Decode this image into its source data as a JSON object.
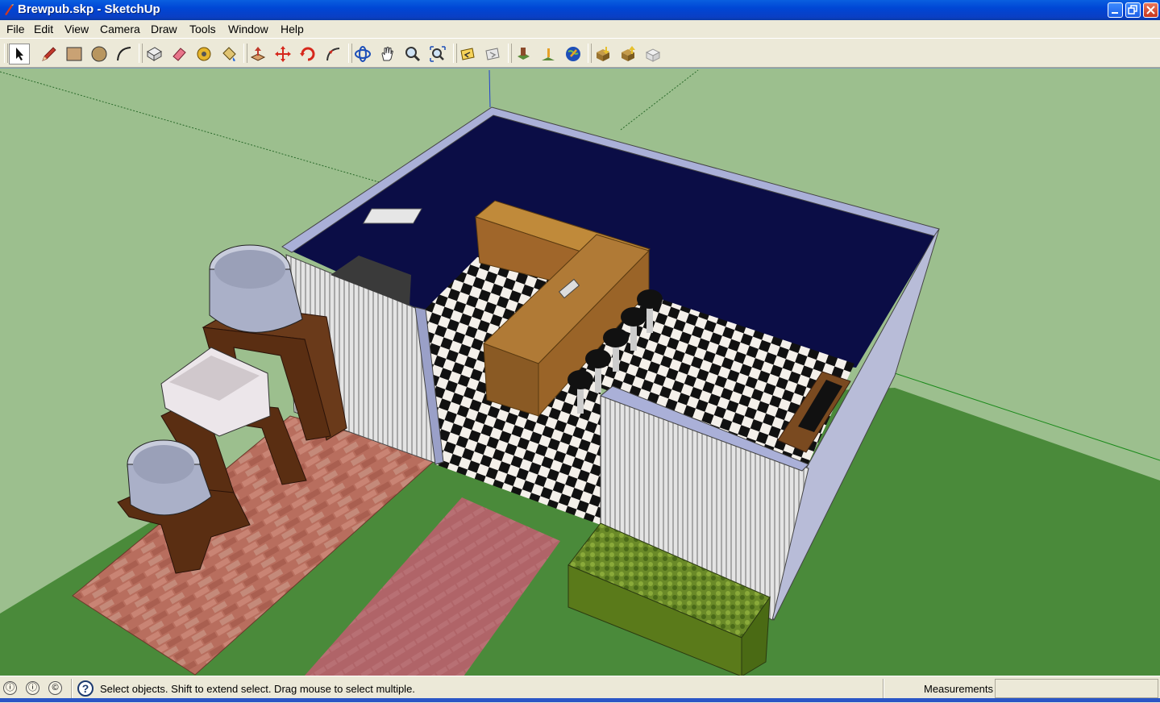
{
  "window": {
    "title": "Brewpub.skp - SketchUp"
  },
  "menu": [
    "File",
    "Edit",
    "View",
    "Camera",
    "Draw",
    "Tools",
    "Window",
    "Help"
  ],
  "toolbar": {
    "tools": [
      "select-tool",
      "pencil-tool",
      "rectangle-tool",
      "circle-tool",
      "arc-tool",
      "make-component-tool",
      "eraser-tool",
      "tape-measure-tool",
      "paint-bucket-tool",
      "push-pull-tool",
      "move-tool",
      "rotate-tool",
      "follow-me-tool",
      "orbit-tool",
      "pan-tool",
      "zoom-tool",
      "zoom-extents-tool",
      "previous-view-tool",
      "next-view-tool",
      "add-location-tool",
      "toggle-terrain-tool",
      "google-earth-tool",
      "get-models-tool",
      "share-model-tool",
      "send-to-layout-tool"
    ]
  },
  "status": {
    "message": "Select objects. Shift to extend select. Drag mouse to select multiple.",
    "measurements_label": "Measurements",
    "measurements_value": ""
  },
  "colors": {
    "sky": "#9cbf8e",
    "ground": "#4a8a3a",
    "wall_dark": "#0b0d46",
    "titlebar": "#0a50d8"
  }
}
